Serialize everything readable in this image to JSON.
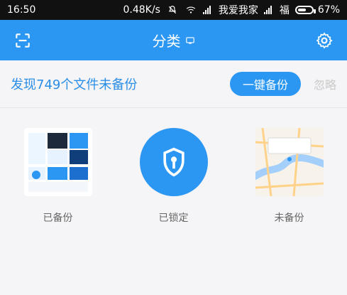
{
  "status": {
    "time": "16:50",
    "speed": "0.48K/s",
    "carrier1": "我爱我家",
    "carrier2": "福",
    "battery": "67%"
  },
  "appbar": {
    "title": "分类"
  },
  "summary": {
    "text": "发现749个文件未备份",
    "backup_button": "一键备份",
    "ignore": "忽略"
  },
  "tiles": [
    {
      "label": "已备份",
      "icon": "photos-thumbnail"
    },
    {
      "label": "已锁定",
      "icon": "shield-lock-icon"
    },
    {
      "label": "未备份",
      "icon": "map-thumbnail"
    }
  ],
  "colors": {
    "accent": "#2b97f3",
    "text_blue": "#2b8ee6",
    "muted": "#c9c9c9"
  }
}
